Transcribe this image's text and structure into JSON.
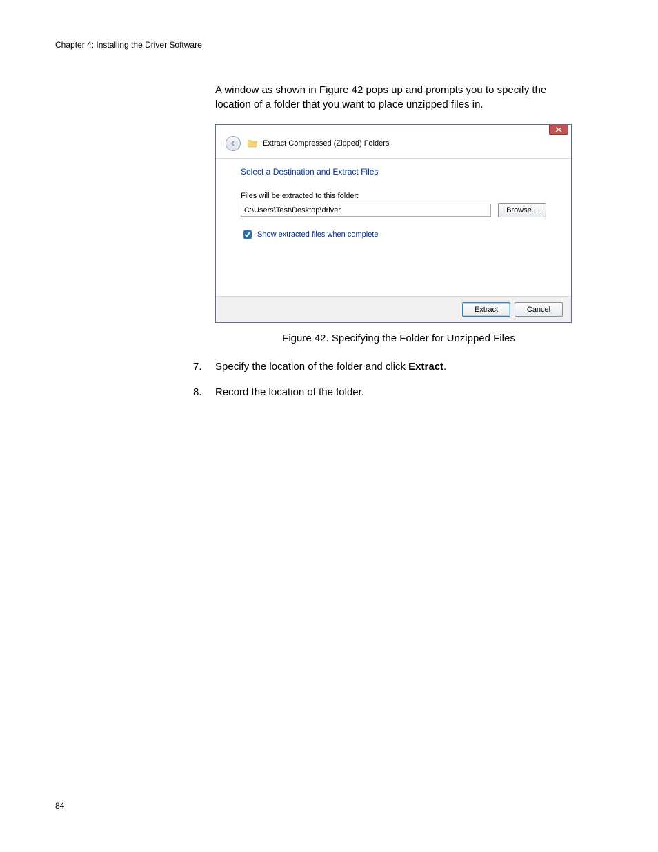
{
  "header": {
    "chapter": "Chapter 4: Installing the Driver Software"
  },
  "page_number": "84",
  "intro_paragraph": "A window as shown in Figure 42 pops up and prompts you to specify the location of a folder that you want to place unzipped files in.",
  "dialog": {
    "title": "Extract Compressed (Zipped) Folders",
    "instruction": "Select a Destination and Extract Files",
    "field_label": "Files will be extracted to this folder:",
    "path_value": "C:\\Users\\Test\\Desktop\\driver",
    "browse_label": "Browse...",
    "checkbox_label": "Show extracted files when complete",
    "checkbox_checked": true,
    "extract_label": "Extract",
    "cancel_label": "Cancel"
  },
  "figure_caption": "Figure 42. Specifying the Folder for Unzipped Files",
  "steps": [
    {
      "num": "7.",
      "text_before": "Specify the location of the folder and click ",
      "bold": "Extract",
      "text_after": "."
    },
    {
      "num": "8.",
      "text_before": "Record the location of the folder.",
      "bold": "",
      "text_after": ""
    }
  ]
}
